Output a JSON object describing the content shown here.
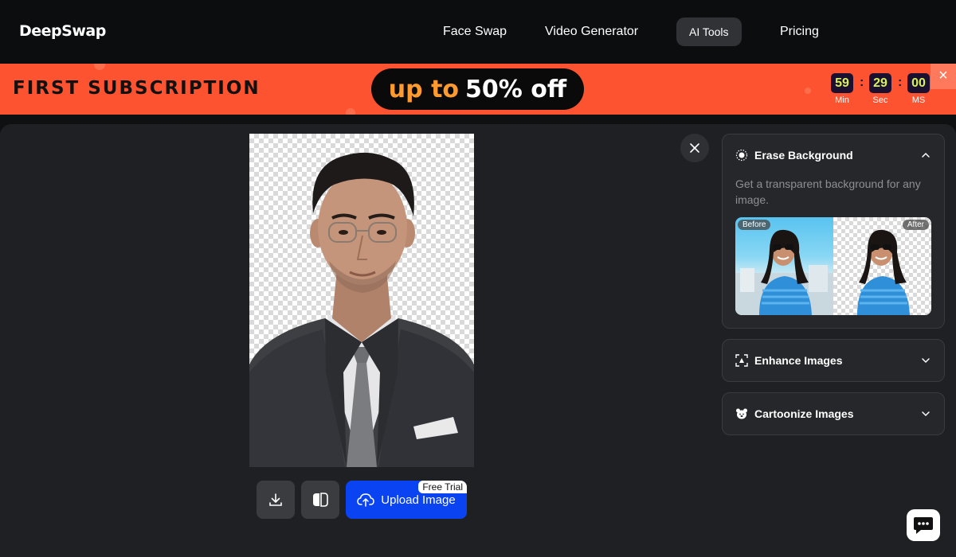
{
  "header": {
    "logo": "DeepSwap",
    "nav": {
      "face_swap": "Face Swap",
      "video_generator": "Video Generator",
      "ai_tools": "AI Tools",
      "pricing": "Pricing"
    }
  },
  "promo": {
    "title": "FIRST SUBSCRIPTION",
    "offer_prefix": "up to",
    "offer_main": "50% off",
    "countdown": {
      "minutes": "59",
      "minutes_unit": "Min",
      "seconds": "29",
      "seconds_unit": "Sec",
      "ms": "00",
      "ms_unit": "MS"
    },
    "close_glyph": "×"
  },
  "workspace": {
    "upload_label": "Upload Image",
    "free_trial_badge": "Free Trial"
  },
  "tools": {
    "erase": {
      "title": "Erase Background",
      "description": "Get a transparent background for any image.",
      "before_label": "Before",
      "after_label": "After"
    },
    "enhance": {
      "title": "Enhance Images"
    },
    "cartoonize": {
      "title": "Cartoonize Images"
    }
  },
  "colors": {
    "promo_bg": "#fd5330",
    "accent_blue": "#0a43f2",
    "timer_digits": "#d8f25a",
    "panel_bg": "#26272a"
  },
  "icons": {
    "download": "download-icon",
    "compare": "compare-icon",
    "upload": "cloud-upload-icon",
    "close": "close-icon",
    "erase": "sparkle-icon",
    "enhance": "enhance-icon",
    "cartoon": "bear-icon",
    "chat": "chat-icon"
  }
}
